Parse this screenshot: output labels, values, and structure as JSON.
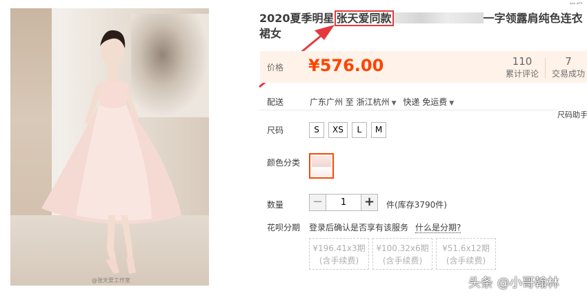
{
  "product": {
    "title_prefix": "2020夏季明星",
    "title_highlight": "张天爱同款",
    "title_suffix": "一字领露肩纯色连衣裙女",
    "image_caption": "@张天爱工作室",
    "top_cut_text": "举报"
  },
  "price": {
    "label": "价格",
    "value": "¥576.00",
    "reviews_count": "110",
    "reviews_label": "累计评论",
    "deals_count": "7",
    "deals_label": "交易成功"
  },
  "shipping": {
    "label": "配送",
    "from": "广东广州 至",
    "to": "浙江杭州",
    "method": "快递 免运费",
    "size_help": "尺码助手"
  },
  "size": {
    "label": "尺码",
    "options": [
      "S",
      "XS",
      "L",
      "M"
    ]
  },
  "color": {
    "label": "颜色分类"
  },
  "quantity": {
    "label": "数量",
    "minus": "−",
    "value": "1",
    "plus": "+",
    "stock": "件(库存3790件)"
  },
  "installment": {
    "label": "花呗分期",
    "login_text": "登录后确认是否享有该服务",
    "what_link": "什么是分期?",
    "plans": [
      {
        "amount": "¥196.41x3期",
        "fee": "(含手续费)"
      },
      {
        "amount": "¥100.32x6期",
        "fee": "(含手续费)"
      },
      {
        "amount": "¥51.6x12期",
        "fee": "(含手续费)"
      }
    ]
  },
  "watermark": "头条 @小哥翰林",
  "colors": {
    "price": "#ff4400",
    "highlight_box": "#e4393c",
    "price_bg": "#fff2e8"
  }
}
